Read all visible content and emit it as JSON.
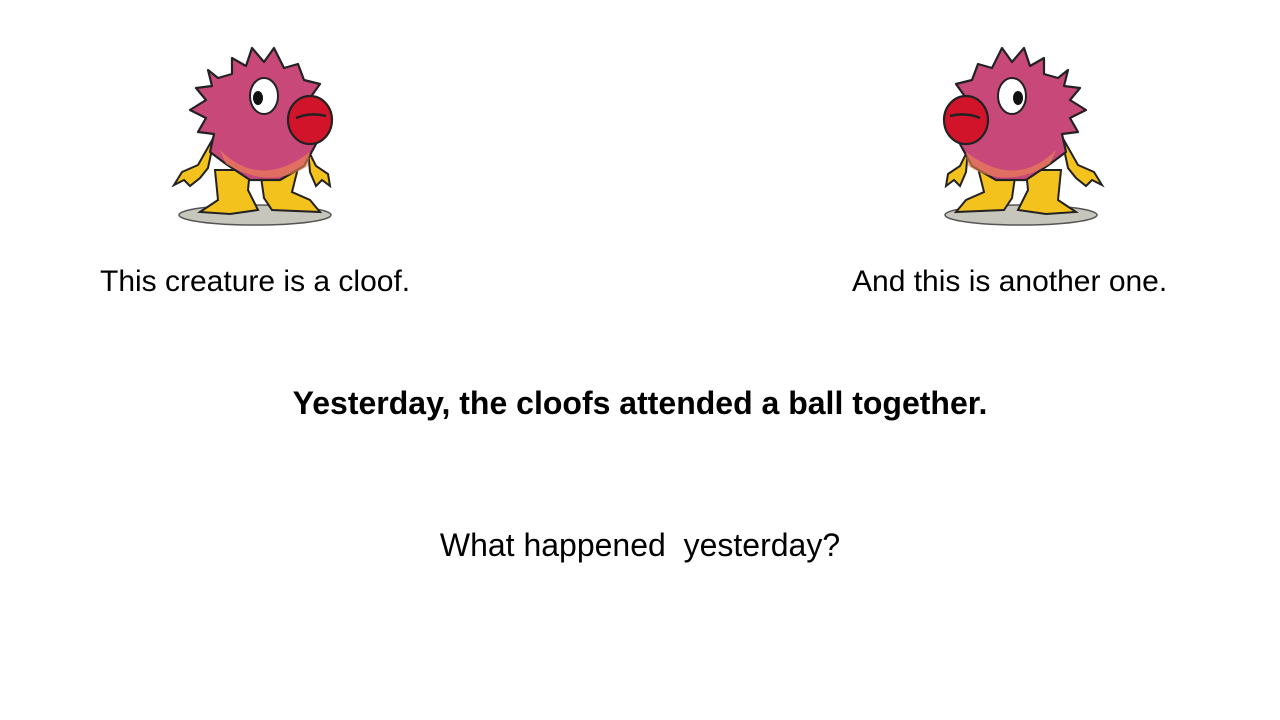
{
  "slide": {
    "caption_left": "This creature is a cloof.",
    "caption_right": "And this is another one.",
    "headline": "Yesterday, the cloofs attended a ball together.",
    "question": "What happened  yesterday?"
  },
  "creatures": [
    {
      "facing": "right",
      "icon": "cloof-creature-illustration"
    },
    {
      "facing": "left",
      "icon": "cloof-creature-illustration"
    }
  ],
  "colors": {
    "background": "#ffffff",
    "body_pink": "#c9487a",
    "lips_red": "#d2142b",
    "limbs_yellow": "#f4c21c",
    "shadow_gray": "#bdbdb5"
  }
}
